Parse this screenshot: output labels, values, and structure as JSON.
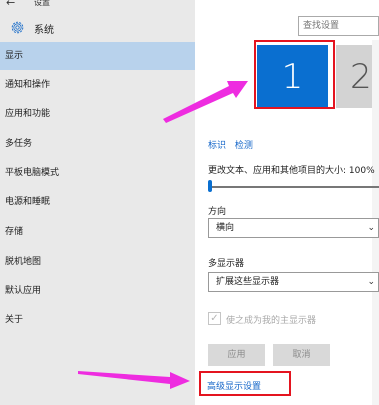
{
  "window": {
    "title": "设置",
    "back_icon": "back-arrow-icon"
  },
  "header": {
    "system_label": "系统",
    "system_icon": "gear-icon"
  },
  "search": {
    "placeholder": "查找设置"
  },
  "sidebar": {
    "items": [
      {
        "label": "显示",
        "active": true
      },
      {
        "label": "通知和操作",
        "active": false
      },
      {
        "label": "应用和功能",
        "active": false
      },
      {
        "label": "多任务",
        "active": false
      },
      {
        "label": "平板电脑模式",
        "active": false
      },
      {
        "label": "电源和睡眠",
        "active": false
      },
      {
        "label": "存储",
        "active": false
      },
      {
        "label": "脱机地图",
        "active": false
      },
      {
        "label": "默认应用",
        "active": false
      },
      {
        "label": "关于",
        "active": false
      }
    ]
  },
  "main": {
    "monitors": [
      {
        "number": "1",
        "selected": true
      },
      {
        "number": "2",
        "selected": false
      }
    ],
    "links": {
      "identify": "标识",
      "detect": "检测"
    },
    "scale_label": "更改文本、应用和其他项目的大小: 100%",
    "orientation": {
      "label": "方向",
      "value": "横向"
    },
    "multi_display": {
      "label": "多显示器",
      "value": "扩展这些显示器"
    },
    "main_display_checkbox": {
      "label": "使之成为我的主显示器",
      "checked": true,
      "disabled": true
    },
    "buttons": {
      "apply": "应用",
      "cancel": "取消"
    },
    "advanced_link": "高级显示设置"
  },
  "annotations": {
    "highlight_color": "#e4141f",
    "arrow_color": "#ee2ce0"
  },
  "colors": {
    "accent": "#0a6fd0",
    "sidebar_active": "#b8d2ec",
    "link": "#1667c9"
  }
}
